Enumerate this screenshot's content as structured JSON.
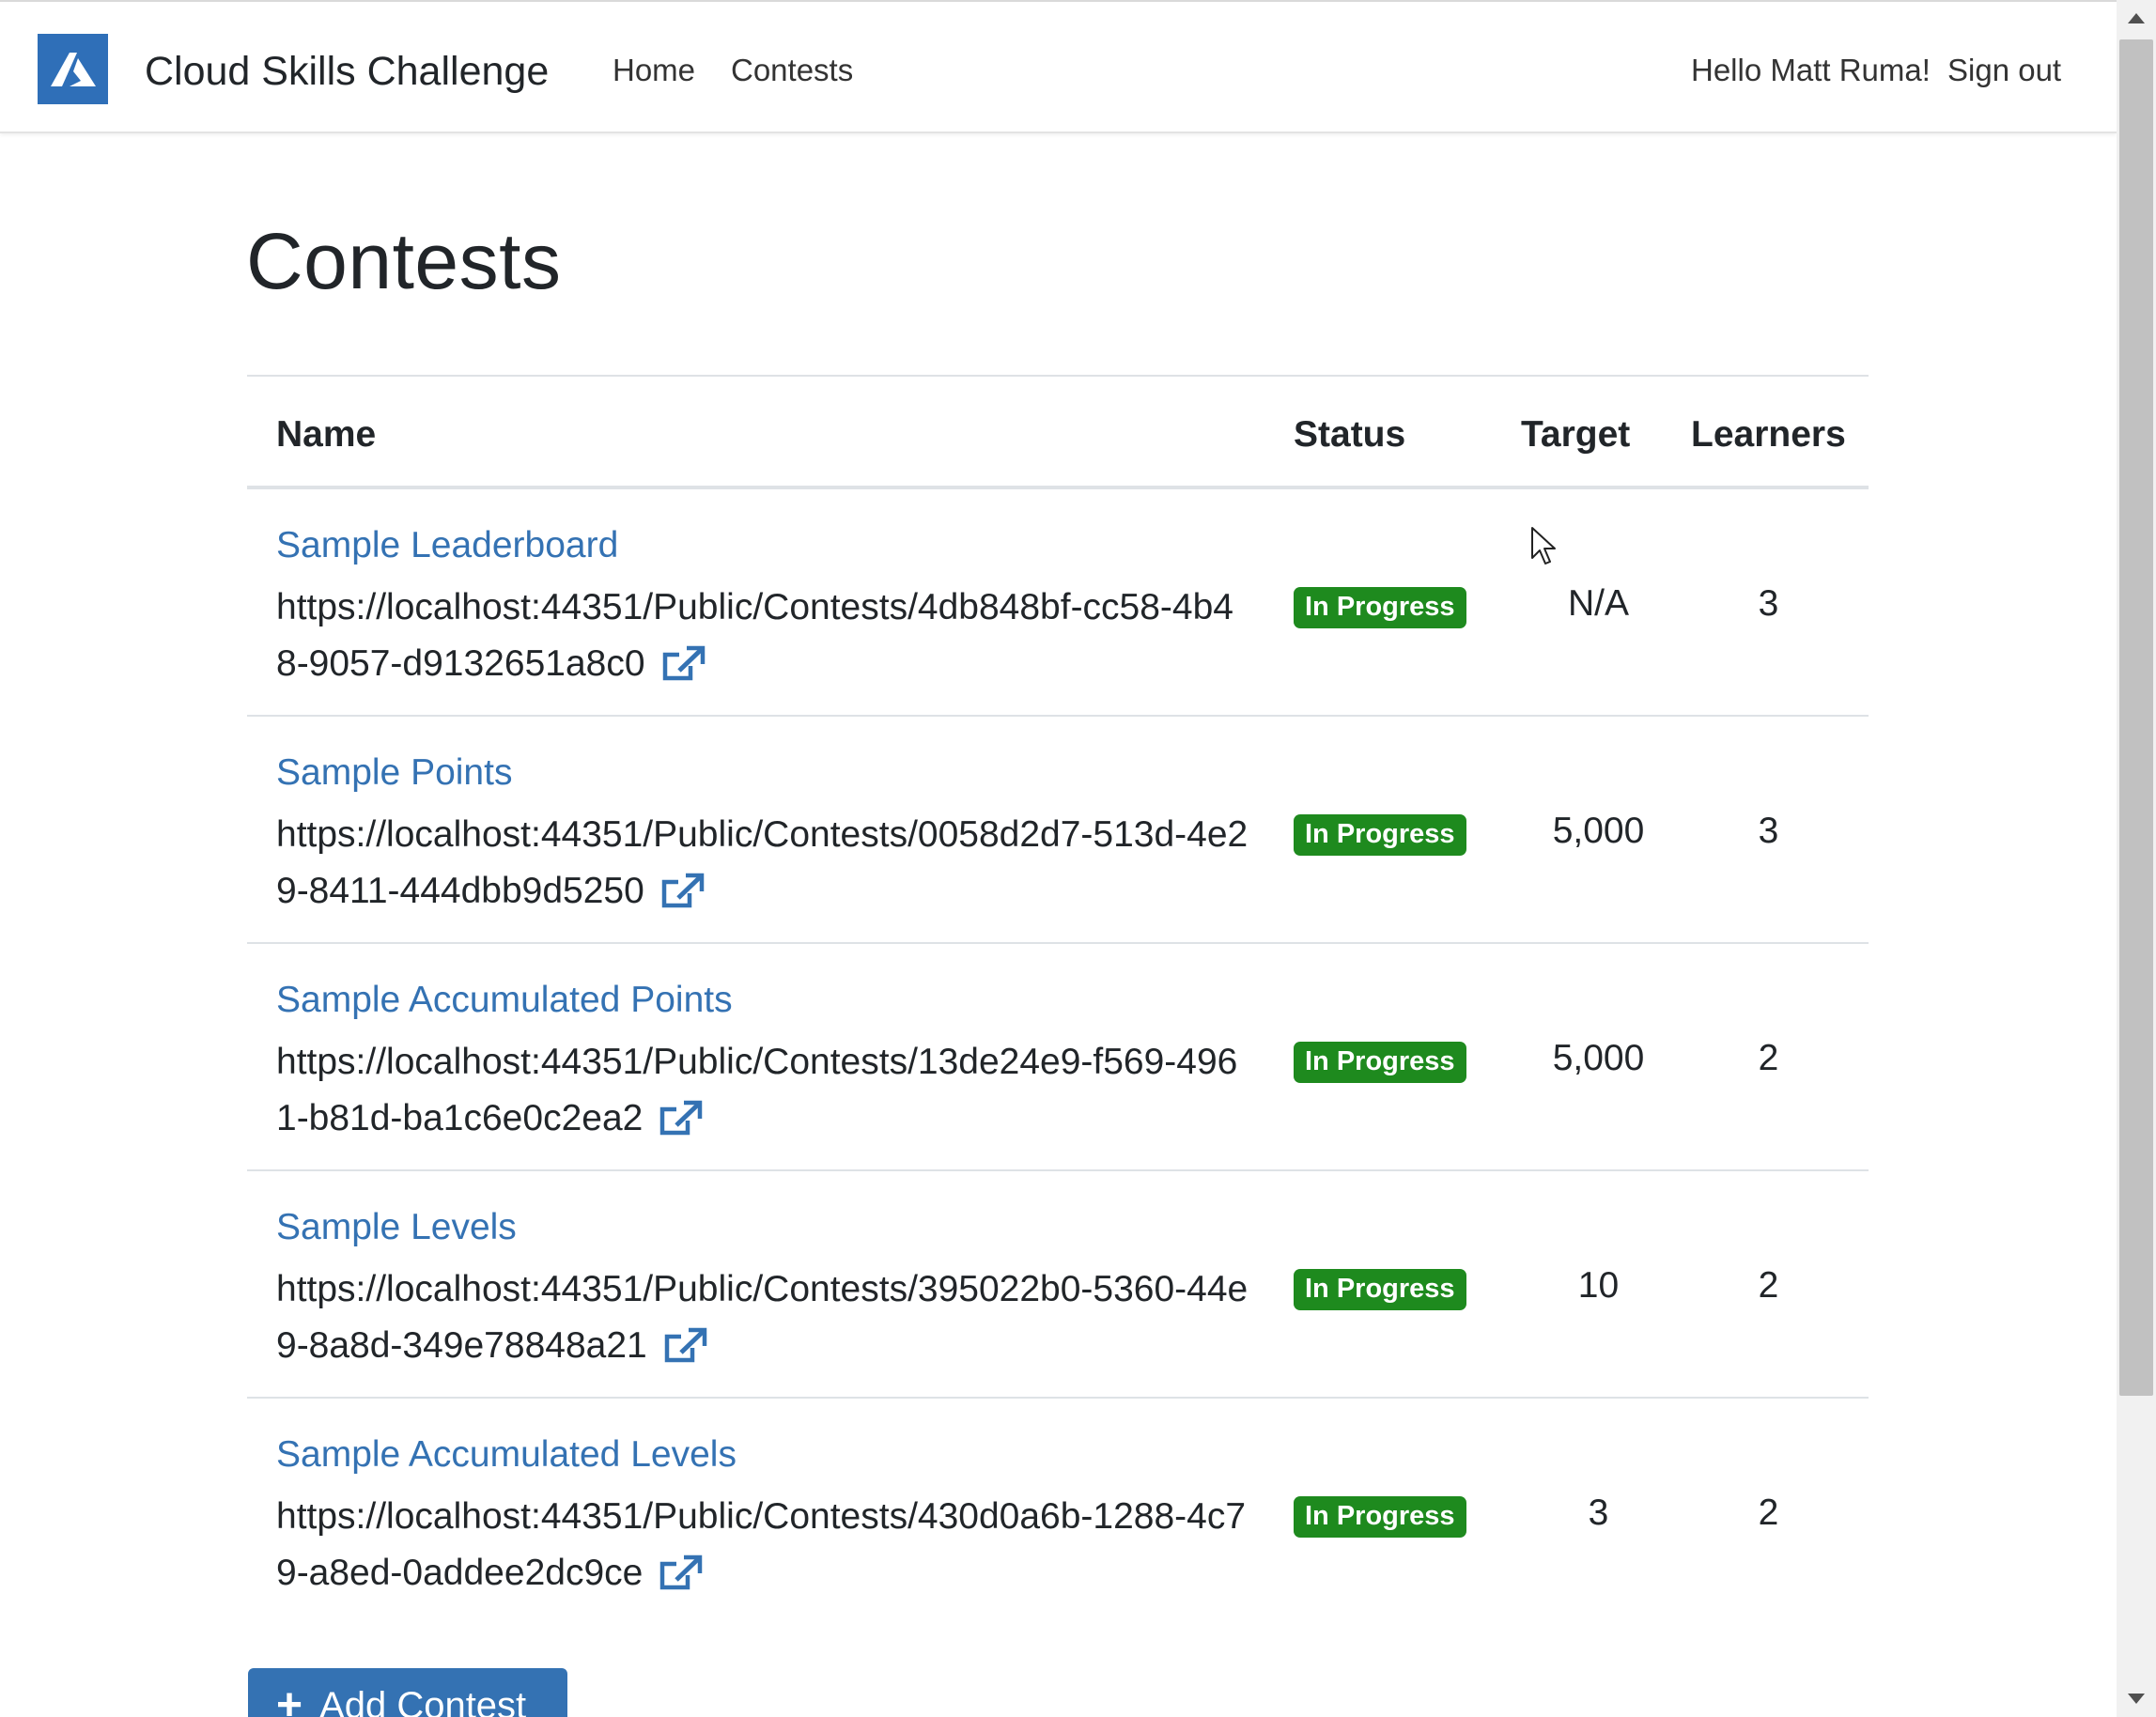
{
  "app": {
    "brand": "Cloud Skills Challenge",
    "logo_icon": "azure-logo-icon"
  },
  "nav": {
    "home": "Home",
    "contests": "Contests",
    "greeting": "Hello Matt Ruma!",
    "signout": "Sign out"
  },
  "page": {
    "title": "Contests"
  },
  "table": {
    "headers": {
      "name": "Name",
      "status": "Status",
      "target": "Target",
      "learners": "Learners"
    },
    "rows": [
      {
        "name": "Sample Leaderboard",
        "url": "https://localhost:44351/Public/Contests/4db848bf-cc58-4b48-9057-d9132651a8c0",
        "status": "In Progress",
        "target": "N/A",
        "learners": "3"
      },
      {
        "name": "Sample Points",
        "url": "https://localhost:44351/Public/Contests/0058d2d7-513d-4e29-8411-444dbb9d5250",
        "status": "In Progress",
        "target": "5,000",
        "learners": "3"
      },
      {
        "name": "Sample Accumulated Points",
        "url": "https://localhost:44351/Public/Contests/13de24e9-f569-4961-b81d-ba1c6e0c2ea2",
        "status": "In Progress",
        "target": "5,000",
        "learners": "2"
      },
      {
        "name": "Sample Levels",
        "url": "https://localhost:44351/Public/Contests/395022b0-5360-44e9-8a8d-349e78848a21",
        "status": "In Progress",
        "target": "10",
        "learners": "2"
      },
      {
        "name": "Sample Accumulated Levels",
        "url": "https://localhost:44351/Public/Contests/430d0a6b-1288-4c79-a8ed-0addee2dc9ce",
        "status": "In Progress",
        "target": "3",
        "learners": "2"
      }
    ]
  },
  "actions": {
    "add_contest": "Add Contest"
  },
  "colors": {
    "link": "#3472b3",
    "badge_success": "#1e8a1e",
    "brand_blue": "#2f6fb8"
  }
}
